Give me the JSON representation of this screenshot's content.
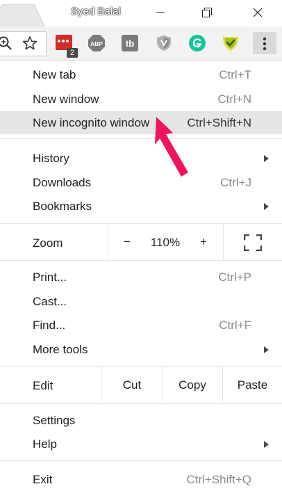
{
  "window": {
    "user_name": "Syed Balal",
    "controls": [
      "minimize-icon",
      "restore-icon",
      "close-icon"
    ]
  },
  "toolbar": {
    "icons": [
      "zoom-in-icon",
      "star-icon"
    ],
    "extensions": [
      {
        "name": "lastpass-icon",
        "badge": "2",
        "color": "#d32d27"
      },
      {
        "name": "adblock-plus-icon",
        "text": "ABP",
        "color": "#7a7a7a"
      },
      {
        "name": "tubebuddy-icon",
        "text": "tb",
        "color": "#7a7a7a"
      },
      {
        "name": "shield-icon",
        "color": "#9a9a9a"
      },
      {
        "name": "grammarly-icon",
        "color": "#15c39a"
      },
      {
        "name": "check-badge-icon",
        "color": "#9ac31c"
      }
    ],
    "menu_icon": "more-vert-icon"
  },
  "menu": {
    "new_tab": {
      "label": "New tab",
      "shortcut": "Ctrl+T"
    },
    "new_window": {
      "label": "New window",
      "shortcut": "Ctrl+N"
    },
    "new_incognito": {
      "label": "New incognito window",
      "shortcut": "Ctrl+Shift+N"
    },
    "history": {
      "label": "History"
    },
    "downloads": {
      "label": "Downloads",
      "shortcut": "Ctrl+J"
    },
    "bookmarks": {
      "label": "Bookmarks"
    },
    "zoom": {
      "label": "Zoom",
      "minus": "−",
      "value": "110%",
      "plus": "+",
      "fullscreen_icon": "fullscreen-icon"
    },
    "print": {
      "label": "Print...",
      "shortcut": "Ctrl+P"
    },
    "cast": {
      "label": "Cast..."
    },
    "find": {
      "label": "Find...",
      "shortcut": "Ctrl+F"
    },
    "more_tools": {
      "label": "More tools"
    },
    "edit": {
      "label": "Edit",
      "cut": "Cut",
      "copy": "Copy",
      "paste": "Paste"
    },
    "settings": {
      "label": "Settings"
    },
    "help": {
      "label": "Help"
    },
    "exit": {
      "label": "Exit",
      "shortcut": "Ctrl+Shift+Q"
    }
  },
  "annotation": {
    "color": "#f0145a",
    "icon": "pointer-arrow-icon"
  }
}
